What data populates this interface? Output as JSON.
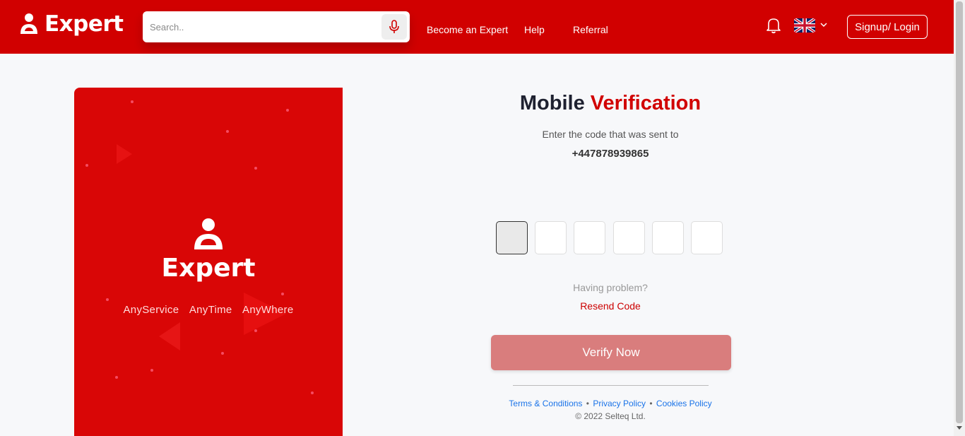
{
  "header": {
    "logo_text": "Expert",
    "search_placeholder": "Search..",
    "nav": [
      {
        "label": "Become an Expert"
      },
      {
        "label": "Help"
      },
      {
        "label": "Referral"
      }
    ],
    "login_label": "Signup/ Login",
    "icons": {
      "mic": "microphone-icon",
      "bell": "bell-icon",
      "flag": "uk-flag-icon",
      "chevron": "chevron-down-icon"
    }
  },
  "promo": {
    "logo_text": "Expert",
    "tagline": [
      "AnyService",
      "AnyTime",
      "AnyWhere"
    ]
  },
  "verification": {
    "title_part1": "Mobile",
    "title_part2": "Verification",
    "subtitle": "Enter the code that was sent to",
    "phone": "+447878939865",
    "code_digits": [
      "",
      "",
      "",
      "",
      "",
      ""
    ],
    "problem_text": "Having problem?",
    "resend_label": "Resend Code",
    "verify_label": "Verify Now"
  },
  "footer": {
    "terms": "Terms & Conditions",
    "privacy": "Privacy Policy",
    "cookies": "Cookies Policy",
    "separator": "•",
    "copyright": "© 2022 Selteq Ltd."
  },
  "colors": {
    "brand_red": "#d10000",
    "verify_button": "#d97d7d",
    "link_blue": "#1a73e8"
  }
}
